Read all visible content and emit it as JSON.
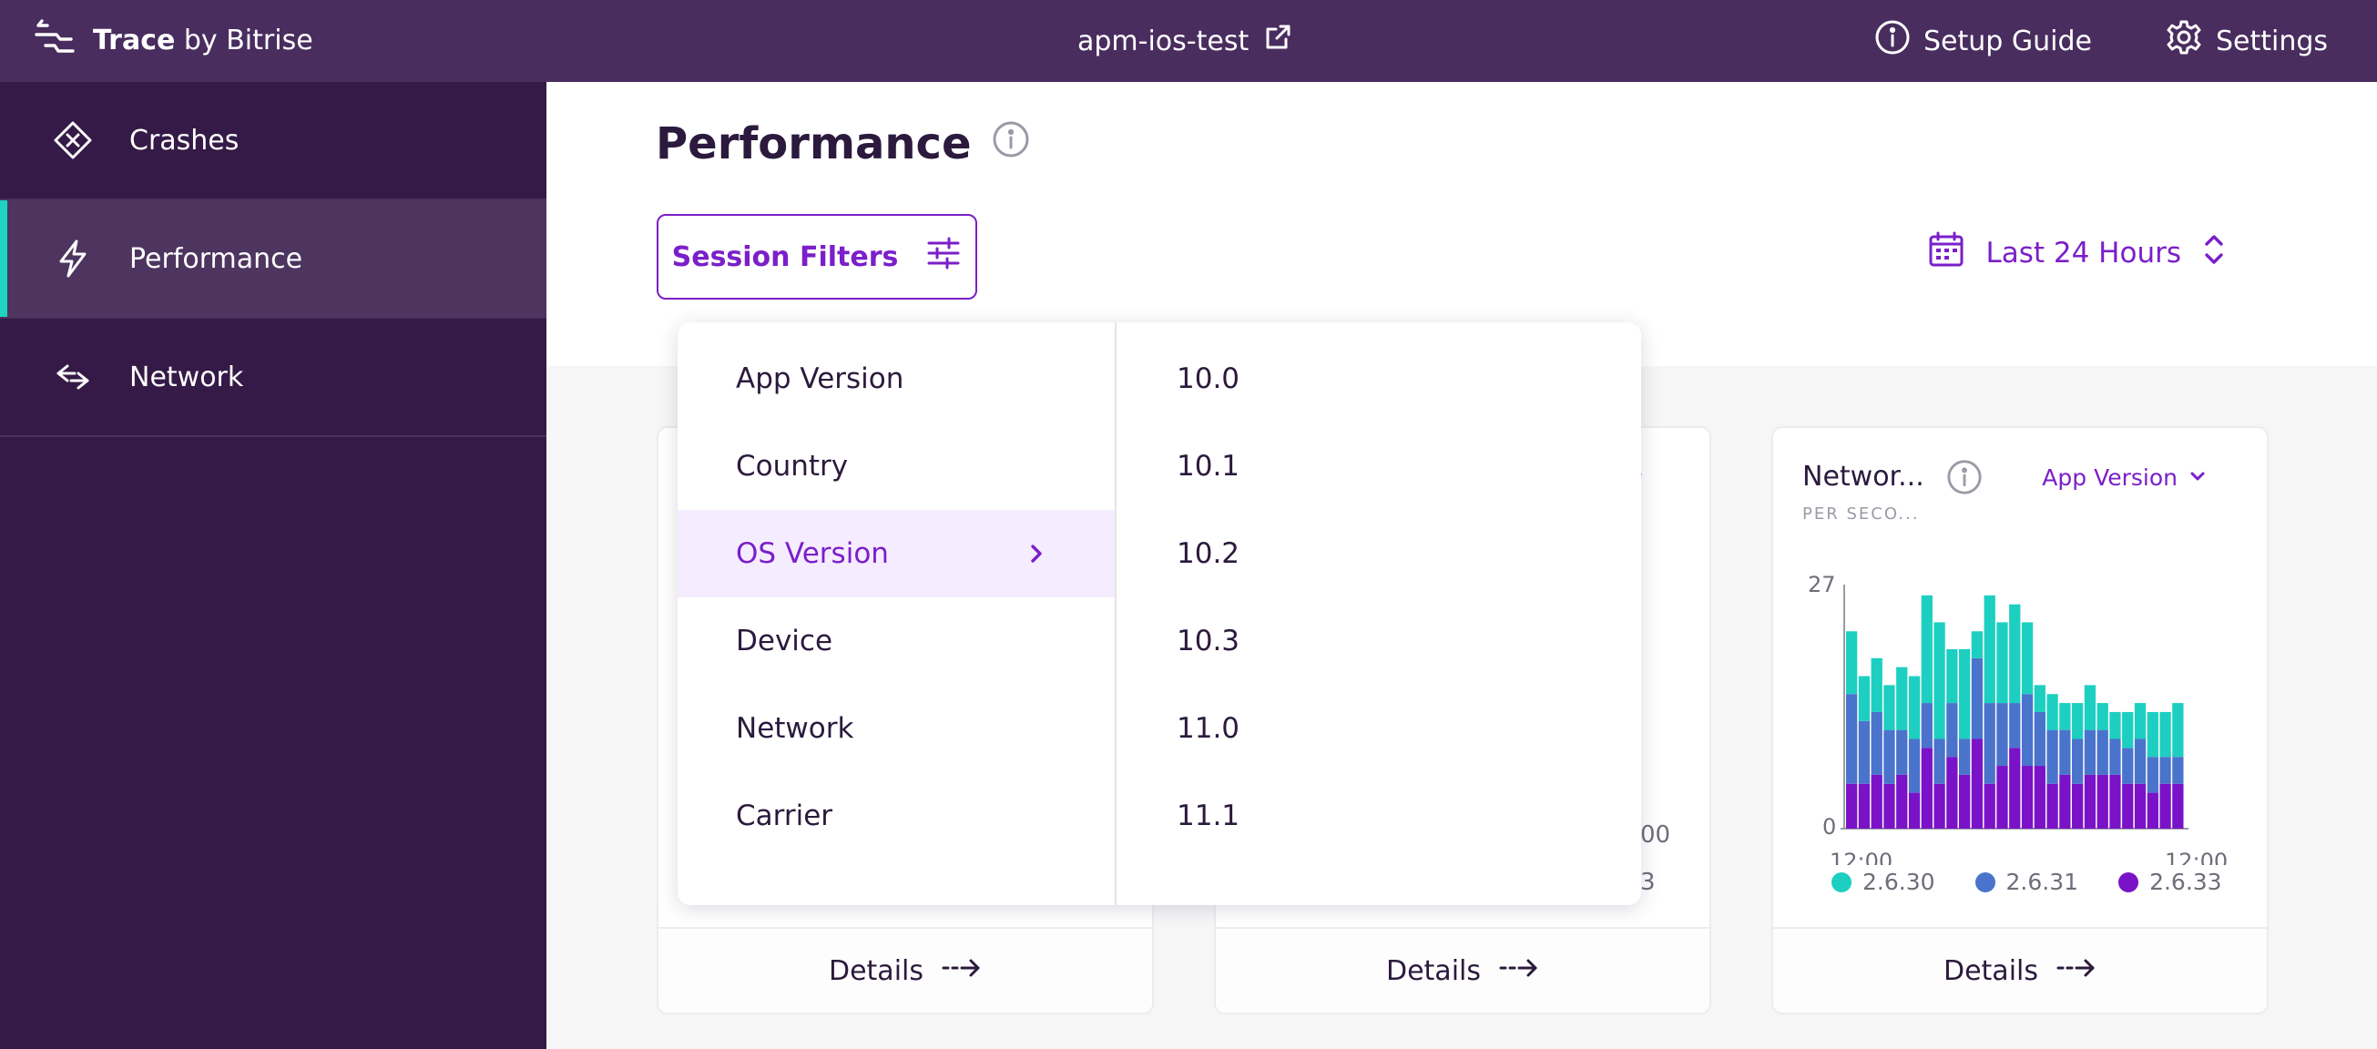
{
  "topbar": {
    "brand_name": "Trace",
    "brand_by": "by Bitrise",
    "app_name": "apm-ios-test",
    "setup_guide": "Setup Guide",
    "settings": "Settings"
  },
  "sidebar": {
    "items": [
      {
        "label": "Crashes",
        "icon": "crash-icon"
      },
      {
        "label": "Performance",
        "icon": "lightning-icon",
        "active": true
      },
      {
        "label": "Network",
        "icon": "network-arrows-icon"
      }
    ]
  },
  "main": {
    "title": "Performance",
    "session_filters": "Session Filters",
    "time_range": "Last 24 Hours"
  },
  "dropdown": {
    "categories": [
      "App Version",
      "Country",
      "OS Version",
      "Device",
      "Network",
      "Carrier"
    ],
    "selected_category": "OS Version",
    "values": [
      "10.0",
      "10.1",
      "10.2",
      "10.3",
      "11.0",
      "11.1"
    ]
  },
  "cards": [
    {
      "details": "Details"
    },
    {
      "details": "Details",
      "partial_tick": "00",
      "partial_legend": "3"
    },
    {
      "title": "Networ...",
      "subtitle": "PER SECO...",
      "group_by": "App Version",
      "details": "Details"
    }
  ],
  "colors": {
    "accent": "#7a1fc9",
    "topbar": "#492d5e",
    "sidebar": "#351a47",
    "active_indicator": "#1fd3c0"
  },
  "chart_data": {
    "type": "bar",
    "stacked": true,
    "ylim": [
      0,
      27
    ],
    "y_ticks": [
      "27",
      "0"
    ],
    "x_ticks": [
      "12:00",
      "12:00"
    ],
    "series": [
      {
        "name": "2.6.30",
        "color": "#1dcfc0",
        "values": [
          7,
          5,
          6,
          5,
          7,
          7,
          12,
          13,
          6,
          10,
          3,
          12,
          9,
          11,
          8,
          3,
          4,
          3,
          4,
          5,
          3,
          3,
          4,
          4,
          5,
          5,
          6
        ]
      },
      {
        "name": "2.6.31",
        "color": "#4a73cc",
        "values": [
          10,
          7,
          7,
          6,
          5,
          6,
          5,
          5,
          6,
          4,
          9,
          9,
          7,
          5,
          8,
          6,
          6,
          5,
          5,
          5,
          5,
          4,
          4,
          5,
          4,
          3,
          3
        ]
      },
      {
        "name": "2.6.33",
        "color": "#7a12c8",
        "values": [
          5,
          5,
          6,
          5,
          6,
          4,
          9,
          5,
          8,
          6,
          10,
          5,
          7,
          9,
          7,
          7,
          5,
          6,
          5,
          6,
          6,
          6,
          5,
          5,
          4,
          5,
          5
        ]
      }
    ]
  }
}
